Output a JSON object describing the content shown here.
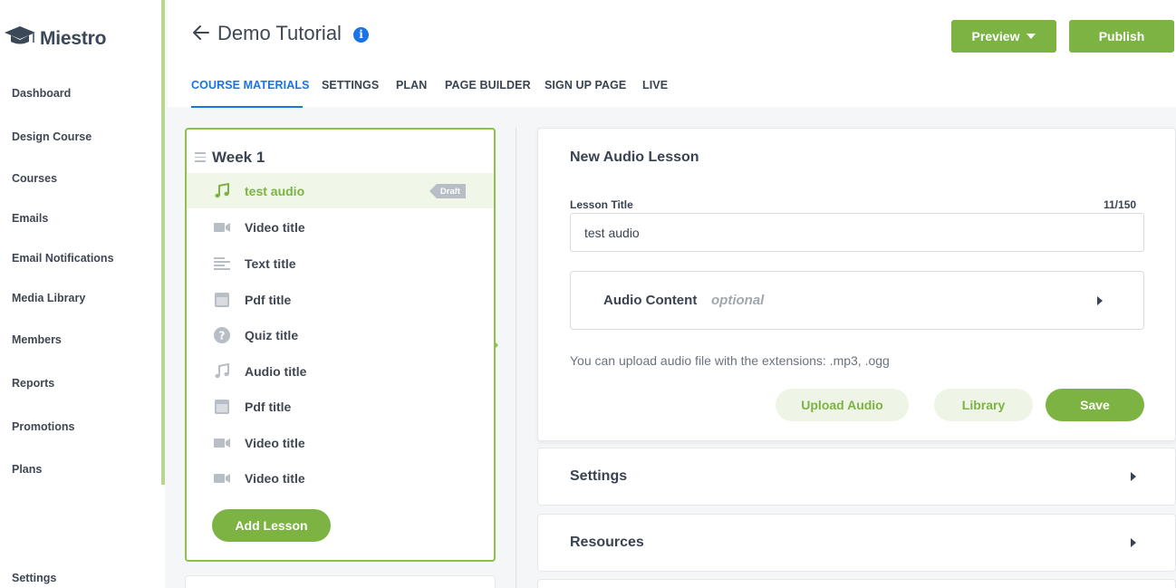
{
  "app": {
    "logo_text": "Miestro"
  },
  "sidebar": {
    "items": [
      {
        "label": "Dashboard"
      },
      {
        "label": "Design Course"
      },
      {
        "label": "Courses"
      },
      {
        "label": "Emails"
      },
      {
        "label": "Email Notifications"
      },
      {
        "label": "Media Library"
      },
      {
        "label": "Members"
      },
      {
        "label": "Reports"
      },
      {
        "label": "Promotions"
      },
      {
        "label": "Plans"
      },
      {
        "label": "Settings"
      }
    ]
  },
  "header": {
    "title": "Demo Tutorial",
    "info_glyph": "i",
    "preview_label": "Preview",
    "publish_label": "Publish",
    "tabs": [
      {
        "label": "COURSE MATERIALS",
        "active": true
      },
      {
        "label": "SETTINGS",
        "active": false
      },
      {
        "label": "PLAN",
        "active": false
      },
      {
        "label": "PAGE BUILDER",
        "active": false
      },
      {
        "label": "SIGN UP PAGE",
        "active": false
      },
      {
        "label": "LIVE",
        "active": false
      }
    ]
  },
  "lessons": {
    "week_title": "Week 1",
    "items": [
      {
        "label": "test audio",
        "icon": "music-icon",
        "active": true,
        "badge": "Draft"
      },
      {
        "label": "Video title",
        "icon": "video-icon"
      },
      {
        "label": "Text title",
        "icon": "text-icon"
      },
      {
        "label": "Pdf title",
        "icon": "pdf-icon"
      },
      {
        "label": "Quiz title",
        "icon": "quiz-icon"
      },
      {
        "label": "Audio title",
        "icon": "music-icon"
      },
      {
        "label": "Pdf title",
        "icon": "pdf-icon"
      },
      {
        "label": "Video title",
        "icon": "video-icon"
      },
      {
        "label": "Video title",
        "icon": "video-icon"
      }
    ],
    "add_label": "Add Lesson"
  },
  "form": {
    "title": "New Audio Lesson",
    "lesson_title_label": "Lesson Title",
    "counter": "11/150",
    "lesson_title_value": "test audio",
    "audio_content_label": "Audio Content",
    "audio_content_optional": "optional",
    "hint": "You can upload audio file with the extensions: .mp3, .ogg",
    "upload_label": "Upload Audio",
    "library_label": "Library",
    "save_label": "Save"
  },
  "sections": {
    "settings_label": "Settings",
    "resources_label": "Resources"
  },
  "colors": {
    "accent_green": "#7cb342",
    "accent_blue": "#1a73e8",
    "text_dark": "#3a4350"
  }
}
